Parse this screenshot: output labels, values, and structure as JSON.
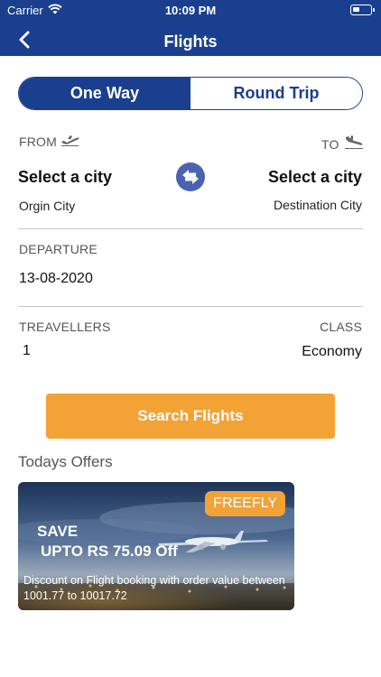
{
  "status_bar": {
    "carrier": "Carrier",
    "time": "10:09 PM"
  },
  "nav": {
    "title": "Flights",
    "back_icon": "chevron-left-icon"
  },
  "trip_type": {
    "options": [
      "One Way",
      "Round Trip"
    ],
    "selected": "One Way"
  },
  "from": {
    "label": "FROM",
    "icon": "plane-takeoff-icon",
    "city": "Select a city",
    "placeholder": "Orgin City"
  },
  "to": {
    "label": "TO",
    "icon": "plane-landing-icon",
    "city": "Select a city",
    "placeholder": "Destination City"
  },
  "departure": {
    "label": "DEPARTURE",
    "date": "13-08-2020"
  },
  "travellers": {
    "label": "TREAVELLERS",
    "count": "1"
  },
  "class": {
    "label": "CLASS",
    "value": "Economy"
  },
  "search_button": {
    "label": "Search Flights"
  },
  "offers": {
    "title": "Todays Offers",
    "items": [
      {
        "code": "FREEFLY",
        "save": "SAVE",
        "headline": "UPTO RS 75.09 Off",
        "description": "Discount on Flight booking with order value between 1001.77 to 10017.72"
      }
    ]
  },
  "colors": {
    "primary": "#1a3f8f",
    "accent": "#f3a236",
    "swap_icon_bg": "#4a63b0"
  }
}
